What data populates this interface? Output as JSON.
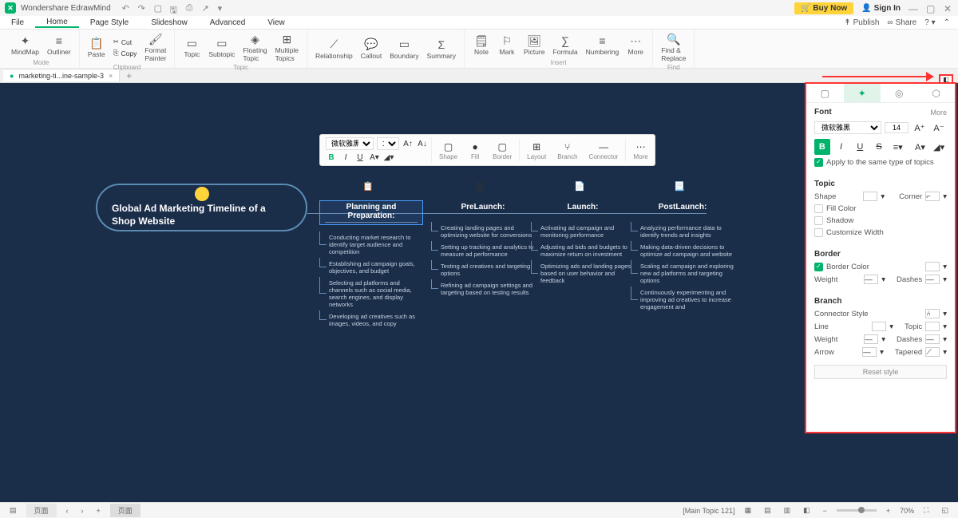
{
  "app": {
    "title": "Wondershare EdrawMind",
    "buy": "Buy Now",
    "signin": "Sign In"
  },
  "menu": {
    "file": "File",
    "home": "Home",
    "pagestyle": "Page Style",
    "slideshow": "Slideshow",
    "advanced": "Advanced",
    "view": "View",
    "publish": "Publish",
    "share": "Share"
  },
  "ribbon": {
    "mindmap": "MindMap",
    "outliner": "Outliner",
    "paste": "Paste",
    "cut": "Cut",
    "copy": "Copy",
    "format_painter": "Format\nPainter",
    "topic": "Topic",
    "subtopic": "Subtopic",
    "floating": "Floating\nTopic",
    "multiple": "Multiple\nTopics",
    "relationship": "Relationship",
    "callout": "Callout",
    "boundary": "Boundary",
    "summary": "Summary",
    "note": "Note",
    "mark": "Mark",
    "picture": "Picture",
    "formula": "Formula",
    "numbering": "Numbering",
    "more": "More",
    "find": "Find &\nReplace",
    "g_mode": "Mode",
    "g_clipboard": "Clipboard",
    "g_topic": "Topic",
    "g_insert": "Insert",
    "g_find": "Find"
  },
  "tab": {
    "name": "marketing-ti...ine-sample-3"
  },
  "float": {
    "font": "微软雅黑",
    "size": "14",
    "shape": "Shape",
    "fill": "Fill",
    "border": "Border",
    "layout": "Layout",
    "branch": "Branch",
    "connector": "Connector",
    "more": "More"
  },
  "mind": {
    "root": "Global Ad Marketing Timeline of a Shop Website",
    "phases": [
      {
        "title": "Planning and Preparation:",
        "items": [
          "Conducting market research to identify target audience and competition",
          "Establishing ad campaign goals, objectives, and budget",
          "Selecting ad platforms and channels such as social media, search engines, and display networks",
          "Developing ad creatives such as images, videos, and copy"
        ]
      },
      {
        "title": "PreLaunch:",
        "items": [
          "Creating landing pages and optimizing website for conversions",
          "Setting up tracking and analytics to measure ad performance",
          "Testing ad creatives and targeting options",
          "Refining ad campaign settings and targeting based on testing results"
        ]
      },
      {
        "title": "Launch:",
        "items": [
          "Activating ad campaign and monitoring performance",
          "Adjusting ad bids and budgets to maximize return on investment",
          "Optimizing ads and landing pages based on user behavior and feedback"
        ]
      },
      {
        "title": "PostLaunch:",
        "items": [
          "Analyzing performance data to identify trends and insights",
          "Making data-driven decisions to optimize ad campaign and website",
          "Scaling ad campaign and exploring new ad platforms and targeting options",
          "Continuously experimenting and improving ad creatives to increase engagement and"
        ]
      }
    ]
  },
  "panel": {
    "font": "Font",
    "more": "More",
    "font_family": "微软雅黑",
    "font_size": "14",
    "apply": "Apply to the same type of topics",
    "topic": "Topic",
    "shape": "Shape",
    "corner": "Corner",
    "fillcolor": "Fill Color",
    "shadow": "Shadow",
    "custwidth": "Customize Width",
    "border": "Border",
    "bordercolor": "Border Color",
    "weight": "Weight",
    "dashes": "Dashes",
    "branch": "Branch",
    "connstyle": "Connector Style",
    "line": "Line",
    "topic2": "Topic",
    "arrow": "Arrow",
    "tapered": "Tapered",
    "reset": "Reset style"
  },
  "status": {
    "selection": "[Main Topic 121]",
    "zoom": "70%",
    "page": "页面",
    "page2": "页面"
  }
}
